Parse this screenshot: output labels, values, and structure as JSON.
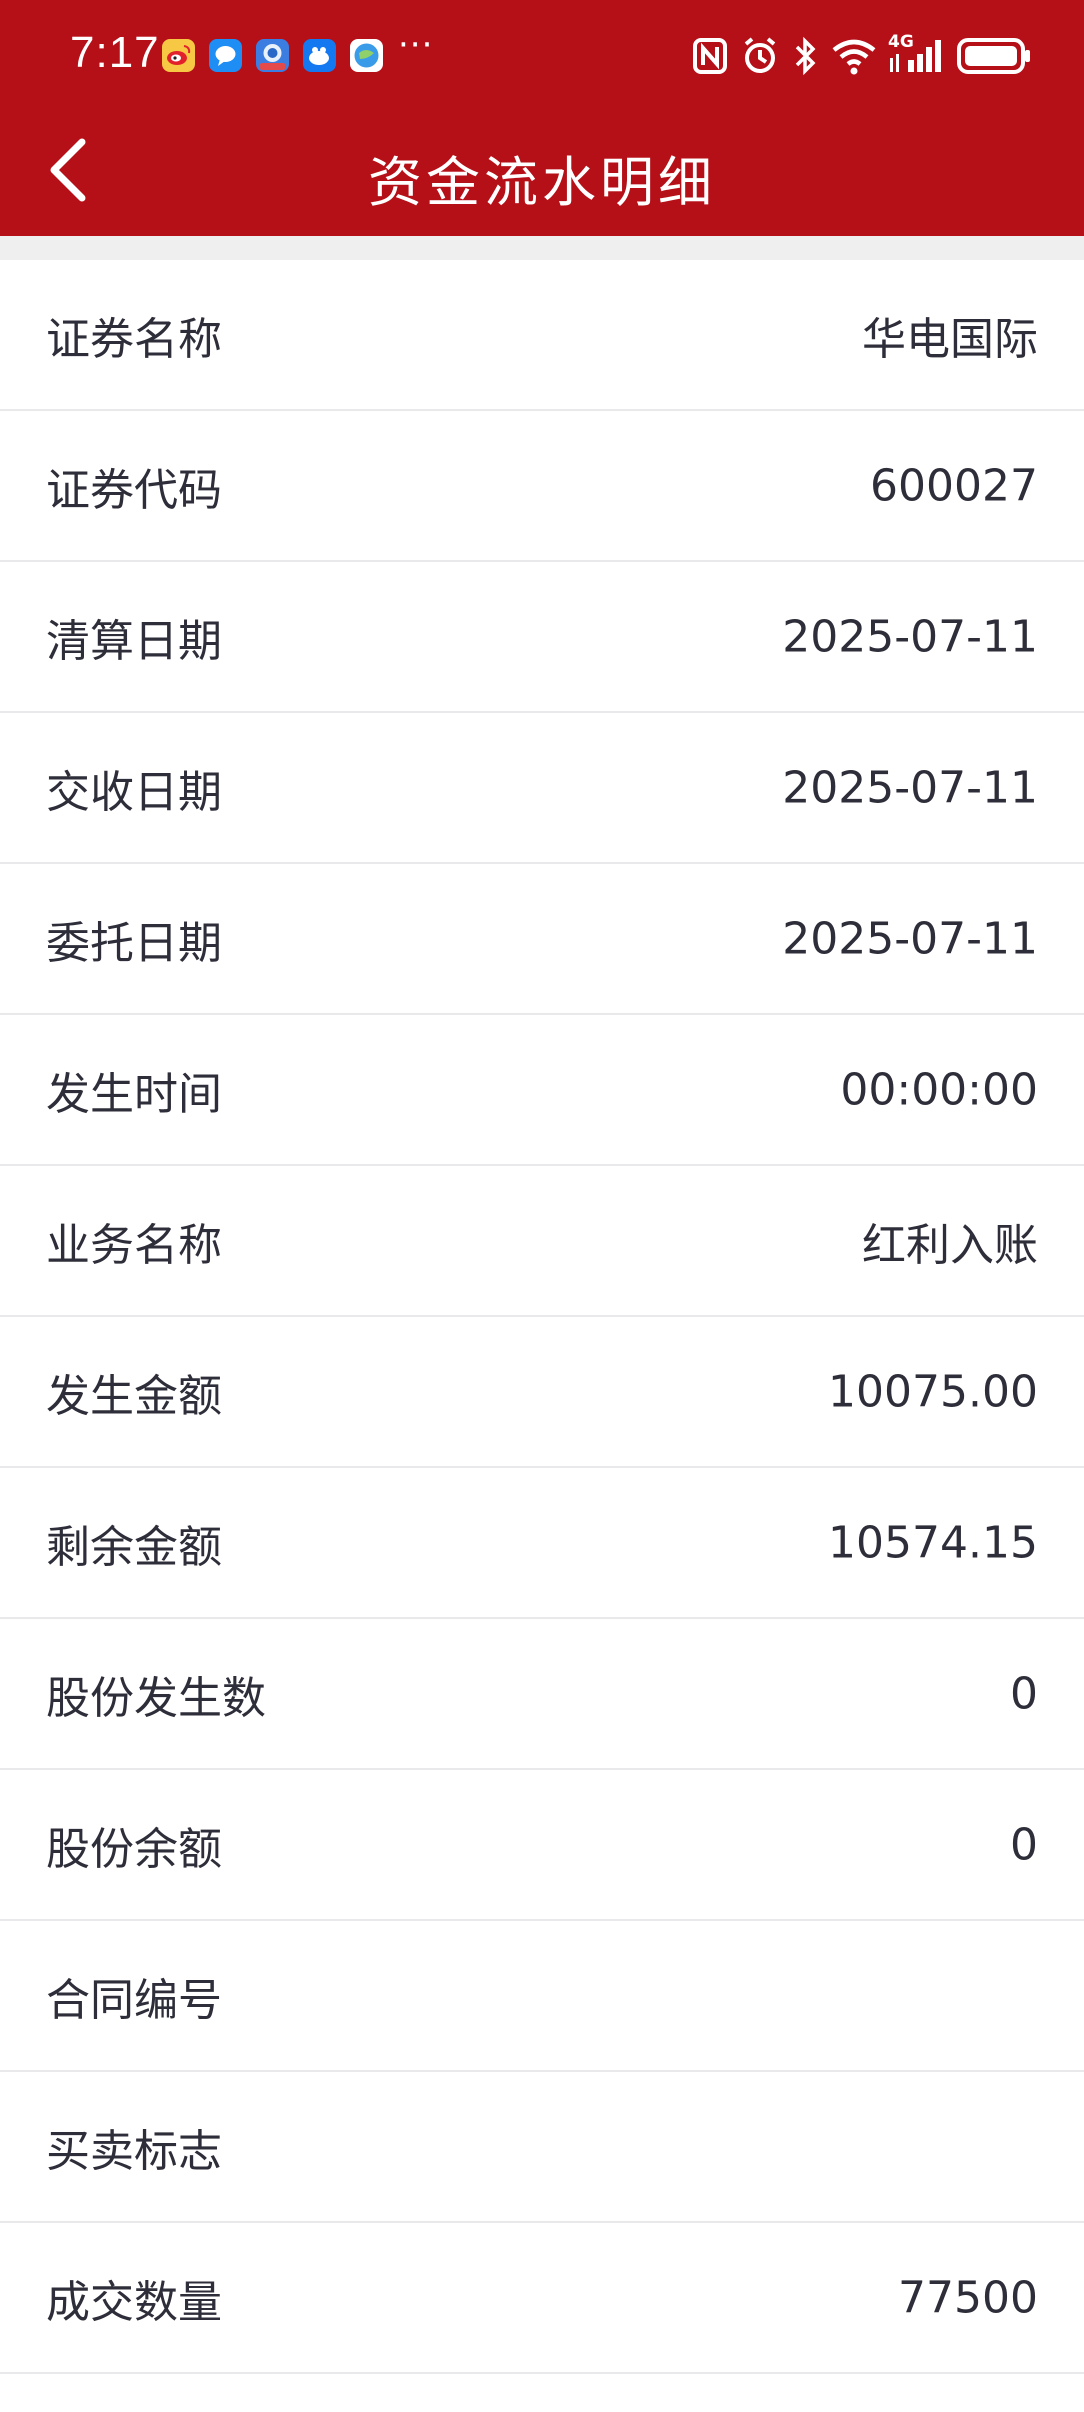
{
  "status_bar": {
    "time": "7:17",
    "more": "···",
    "notification_icons": [
      "weibo-icon",
      "message-icon",
      "app-icon",
      "bird-app-icon",
      "browser-icon"
    ],
    "system_icons": [
      "nfc-icon",
      "alarm-icon",
      "bluetooth-icon",
      "wifi-icon",
      "4g-signal-icon",
      "battery-icon"
    ],
    "network": "4G"
  },
  "header": {
    "title": "资金流水明细",
    "background": "#b50f18"
  },
  "details": [
    {
      "label": "证券名称",
      "value": "华电国际"
    },
    {
      "label": "证券代码",
      "value": "600027"
    },
    {
      "label": "清算日期",
      "value": "2025-07-11"
    },
    {
      "label": "交收日期",
      "value": "2025-07-11"
    },
    {
      "label": "委托日期",
      "value": "2025-07-11"
    },
    {
      "label": "发生时间",
      "value": "00:00:00"
    },
    {
      "label": "业务名称",
      "value": "红利入账"
    },
    {
      "label": "发生金额",
      "value": "10075.00"
    },
    {
      "label": "剩余金额",
      "value": "10574.15"
    },
    {
      "label": "股份发生数",
      "value": "0"
    },
    {
      "label": "股份余额",
      "value": "0"
    },
    {
      "label": "合同编号",
      "value": ""
    },
    {
      "label": "买卖标志",
      "value": ""
    },
    {
      "label": "成交数量",
      "value": "77500"
    }
  ]
}
